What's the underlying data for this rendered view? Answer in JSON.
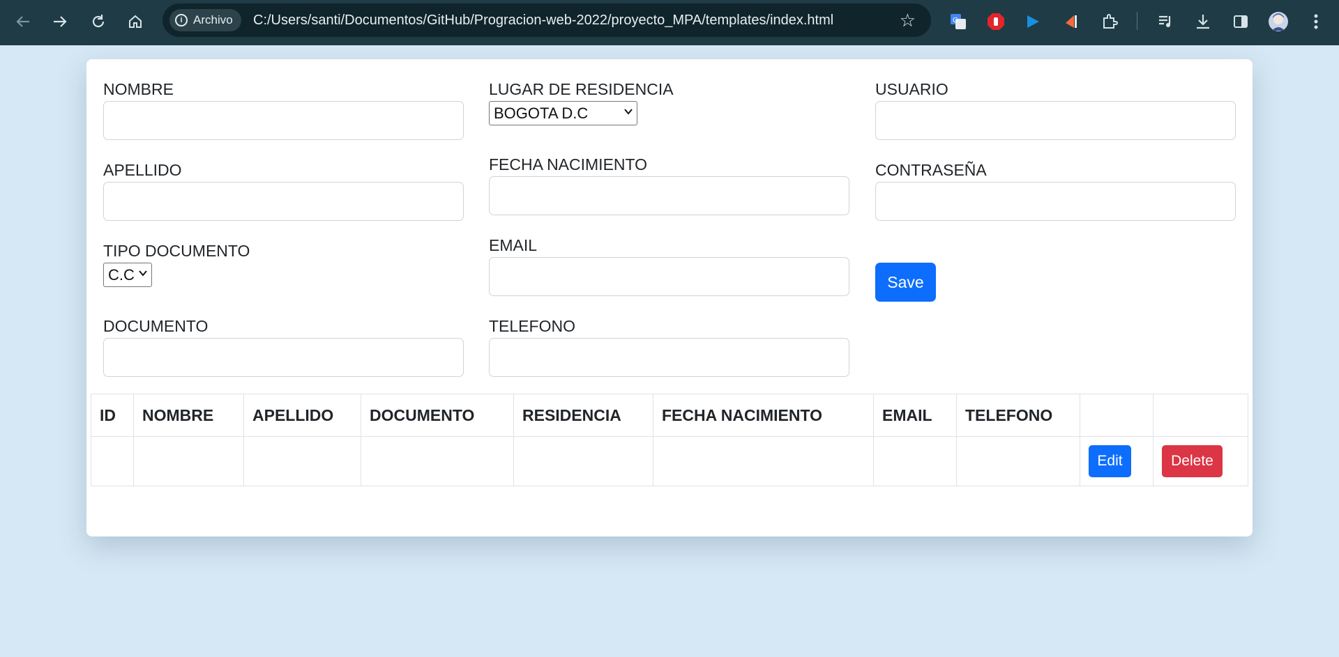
{
  "browser": {
    "chip_label": "Archivo",
    "url": "C:/Users/santi/Documentos/GitHub/Progracion-web-2022/proyecto_MPA/templates/index.html",
    "icons": [
      "back-arrow-icon",
      "forward-arrow-icon",
      "reload-icon",
      "home-icon",
      "info-icon",
      "star-icon",
      "translate-extension-icon",
      "adblock-extension-icon",
      "play-extension-icon",
      "ruler-extension-icon",
      "extensions-puzzle-icon",
      "media-queue-icon",
      "download-icon",
      "side-panel-icon",
      "profile-avatar-icon",
      "menu-kebab-icon"
    ]
  },
  "form": {
    "nombre_label": "NOMBRE",
    "apellido_label": "APELLIDO",
    "tipo_documento_label": "TIPO DOCUMENTO",
    "tipo_documento_value": "C.C",
    "documento_label": "DOCUMENTO",
    "residencia_label": "LUGAR DE RESIDENCIA",
    "residencia_value": "BOGOTA D.C",
    "fecha_label": "FECHA NACIMIENTO",
    "email_label": "EMAIL",
    "telefono_label": "TELEFONO",
    "usuario_label": "USUARIO",
    "contrasena_label": "CONTRASEÑA",
    "save_label": "Save"
  },
  "table": {
    "headers": [
      "ID",
      "NOMBRE",
      "APELLIDO",
      "DOCUMENTO",
      "RESIDENCIA",
      "FECHA NACIMIENTO",
      "EMAIL",
      "TELEFONO"
    ],
    "edit_label": "Edit",
    "delete_label": "Delete"
  },
  "colors": {
    "primary": "#0d6efd",
    "danger": "#dc3545",
    "page_background": "#d6e8f5",
    "browser_chrome": "#1f3b45"
  }
}
